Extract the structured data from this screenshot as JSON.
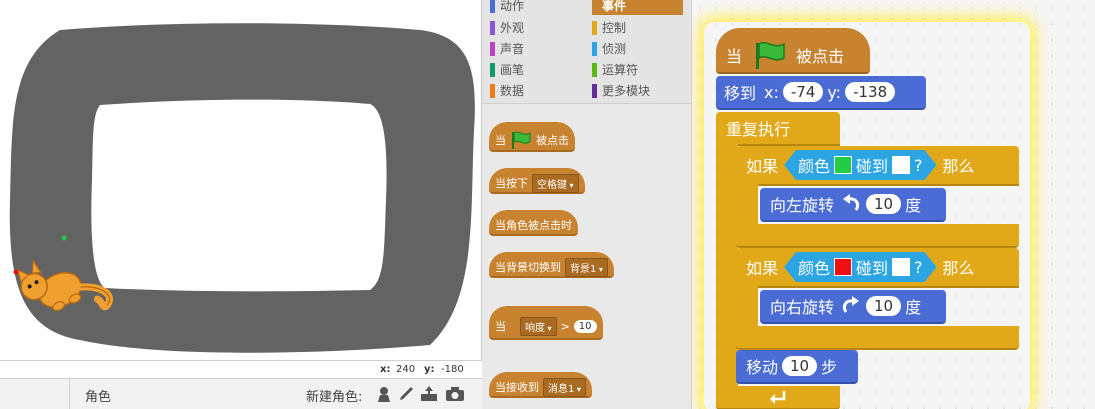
{
  "stage": {
    "coords": {
      "x_label": "x:",
      "x_value": "240",
      "y_label": "y:",
      "y_value": "-180"
    }
  },
  "sprite_bar": {
    "title": "角色",
    "new_sprite_label": "新建角色:",
    "tools": [
      "sprite-library-icon",
      "paint-brush-icon",
      "upload-icon",
      "camera-icon"
    ]
  },
  "categories": {
    "left": [
      {
        "label": "动作",
        "color": "#4a6cd4"
      },
      {
        "label": "外观",
        "color": "#8a55d7"
      },
      {
        "label": "声音",
        "color": "#bb42c3"
      },
      {
        "label": "画笔",
        "color": "#0e9a6c"
      },
      {
        "label": "数据",
        "color": "#ee7d16"
      }
    ],
    "right": [
      {
        "label": "事件",
        "color": "#c88330",
        "active": true
      },
      {
        "label": "控制",
        "color": "#e1a91a"
      },
      {
        "label": "侦测",
        "color": "#2ca5e2"
      },
      {
        "label": "运算符",
        "color": "#5cb712"
      },
      {
        "label": "更多模块",
        "color": "#632d99"
      }
    ]
  },
  "palette_blocks": {
    "when_flag": {
      "pre": "当",
      "post": "被点击"
    },
    "when_key": {
      "pre": "当按下",
      "key": "空格键"
    },
    "when_sprite_clicked": {
      "label": "当角色被点击时"
    },
    "when_backdrop": {
      "pre": "当背景切换到",
      "backdrop": "背景1"
    },
    "when_gt": {
      "pre": "当",
      "sensor": "响度",
      "op": ">",
      "value": "10"
    },
    "when_receive": {
      "pre": "当接收到",
      "message": "消息1"
    }
  },
  "script": {
    "hat": {
      "pre": "当",
      "post": "被点击"
    },
    "goto": {
      "label": "移到",
      "x_label": "x:",
      "x": "-74",
      "y_label": "y:",
      "y": "-138"
    },
    "forever": {
      "label": "重复执行"
    },
    "if1": {
      "if_label": "如果",
      "color_label": "颜色",
      "color": "#22cc44",
      "touch_label": "碰到",
      "touch_color": "#ffffff",
      "q": "?",
      "then_label": "那么",
      "turn": {
        "label": "向左旋转",
        "value": "10",
        "unit": "度"
      }
    },
    "if2": {
      "if_label": "如果",
      "color_label": "颜色",
      "color": "#ee1111",
      "touch_label": "碰到",
      "touch_color": "#ffffff",
      "q": "?",
      "then_label": "那么",
      "turn": {
        "label": "向右旋转",
        "value": "10",
        "unit": "度"
      }
    },
    "move": {
      "label": "移动",
      "value": "10",
      "unit": "步"
    }
  }
}
